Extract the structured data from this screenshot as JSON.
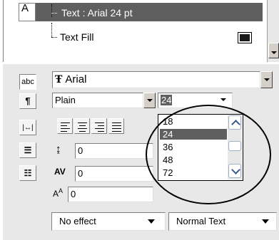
{
  "layers": {
    "text_layer_label": "Text : Arial 24 pt",
    "text_layer_icon": "A",
    "text_fill_label": "Text Fill",
    "fill_color": "#1a1a1a"
  },
  "toolbar": {
    "abc_label": "abc",
    "paragraph_icon": "paragraph-icon",
    "kerning_icon": "kerning-icon",
    "columns_icon": "columns-icon",
    "list_icon": "list-icon"
  },
  "font": {
    "family_value": "Arial",
    "family_icon": "truetype-icon",
    "style_value": "Plain",
    "size_value": "24"
  },
  "size_options": [
    "18",
    "24",
    "36",
    "48",
    "72"
  ],
  "selected_size": "24",
  "spacing": {
    "leading_value": "0",
    "tracking_value": "0",
    "baseline_value": "0"
  },
  "effects": {
    "effect_value": "No effect",
    "text_type_value": "Normal Text"
  },
  "colors": {
    "selection": "#5f5f5f",
    "panel_bg": "#e8e8e8"
  }
}
